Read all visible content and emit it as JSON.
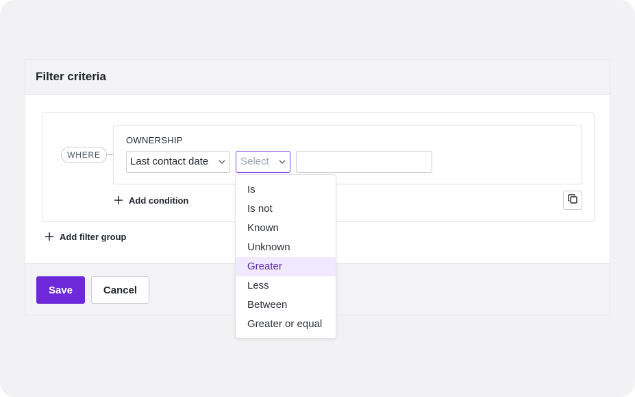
{
  "card": {
    "title": "Filter criteria"
  },
  "filter_group": {
    "where_label": "WHERE",
    "condition": {
      "group_label": "OWNERSHIP",
      "field_value": "Last contact date",
      "operator_placeholder": "Select",
      "value_input": ""
    },
    "add_condition_label": "Add condition",
    "copy_icon": "copy-icon"
  },
  "add_filter_group_label": "Add filter group",
  "footer": {
    "save_label": "Save",
    "cancel_label": "Cancel"
  },
  "operator_dropdown": {
    "highlighted": "Greater",
    "options": [
      "Is",
      "Is not",
      "Known",
      "Unknown",
      "Greater",
      "Less",
      "Between",
      "Greater or equal"
    ]
  },
  "colors": {
    "accent": "#6d28d9",
    "focus_border": "#7c3aed",
    "highlight_bg": "#f1e9fd",
    "canvas_bg": "#f2f2f5"
  }
}
